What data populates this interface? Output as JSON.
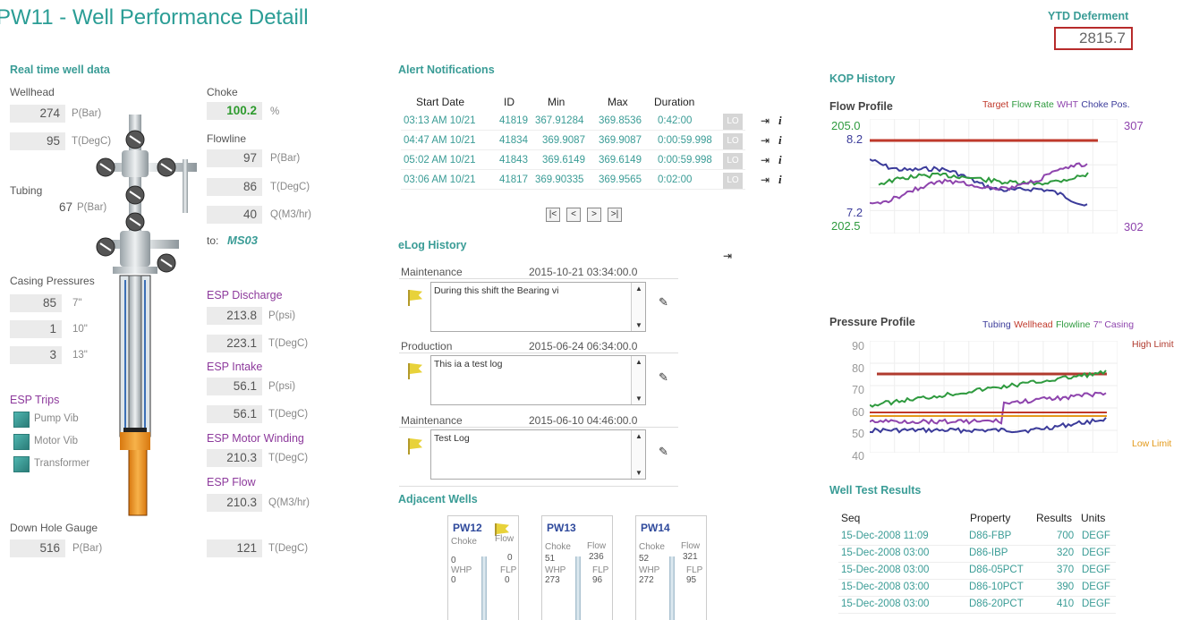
{
  "header": {
    "title": "PW11 - Well Performance Detaill",
    "ytd_label": "YTD Deferment",
    "ytd_value": "2815.7"
  },
  "realtime": {
    "section": "Real time well data",
    "wellhead_label": "Wellhead",
    "wellhead": [
      {
        "value": "274",
        "unit": "P(Bar)"
      },
      {
        "value": "95",
        "unit": "T(DegC)"
      }
    ],
    "tubing_label": "Tubing",
    "tubing": {
      "value": "67",
      "unit": "P(Bar)"
    },
    "choke_label": "Choke",
    "choke": {
      "value": "100.2",
      "unit": "%"
    },
    "flowline_label": "Flowline",
    "flowline": [
      {
        "value": "97",
        "unit": "P(Bar)"
      },
      {
        "value": "86",
        "unit": "T(DegC)"
      },
      {
        "value": "40",
        "unit": "Q(M3/hr)"
      }
    ],
    "to_label": "to:",
    "to_value": "MS03",
    "casing_label": "Casing Pressures",
    "casing": [
      {
        "value": "85",
        "unit": "7\""
      },
      {
        "value": "1",
        "unit": "10\""
      },
      {
        "value": "3",
        "unit": "13\""
      }
    ],
    "esp_trips_label": "ESP Trips",
    "esp_trips": [
      "Pump Vib",
      "Motor Vib",
      "Transformer"
    ],
    "esp_discharge_label": "ESP Discharge",
    "esp_discharge": [
      {
        "value": "213.8",
        "unit": "P(psi)"
      },
      {
        "value": "223.1",
        "unit": "T(DegC)"
      }
    ],
    "esp_intake_label": "ESP Intake",
    "esp_intake": [
      {
        "value": "56.1",
        "unit": "P(psi)"
      },
      {
        "value": "56.1",
        "unit": "T(DegC)"
      }
    ],
    "esp_motor_label": "ESP Motor Winding",
    "esp_motor": {
      "value": "210.3",
      "unit": "T(DegC)"
    },
    "esp_flow_label": "ESP Flow",
    "esp_flow": {
      "value": "210.3",
      "unit": "Q(M3/hr)"
    },
    "dhg_label": "Down Hole Gauge",
    "dhg": {
      "value": "516",
      "unit": "P(Bar)"
    },
    "dhg_temp": {
      "value": "121",
      "unit": "T(DegC)"
    }
  },
  "alerts": {
    "section": "Alert Notifications",
    "headers": [
      "Start Date",
      "ID",
      "Min",
      "Max",
      "Duration"
    ],
    "rows": [
      [
        "03:13 AM 10/21",
        "41819",
        "367.91284",
        "369.8536",
        "0:42:00",
        "LO"
      ],
      [
        "04:47 AM 10/21",
        "41834",
        "369.9087",
        "369.9087",
        "0:00:59.998",
        "LO"
      ],
      [
        "05:02 AM 10/21",
        "41843",
        "369.6149",
        "369.6149",
        "0:00:59.998",
        "LO"
      ],
      [
        "03:06 AM 10/21",
        "41817",
        "369.90335",
        "369.9565",
        "0:02:00",
        "LO"
      ]
    ],
    "nav": [
      "|<",
      "<",
      ">",
      ">|"
    ]
  },
  "elog": {
    "section": "eLog History",
    "entries": [
      {
        "category": "Maintenance",
        "date": "2015-10-21 03:34:00.0",
        "text": "During this shift the Bearing vi"
      },
      {
        "category": "Production",
        "date": "2015-06-24 06:34:00.0",
        "text": "This ia a test log"
      },
      {
        "category": "Maintenance",
        "date": "2015-06-10 04:46:00.0",
        "text": "Test Log"
      }
    ]
  },
  "adjacent": {
    "section": "Adjacent Wells",
    "labels": {
      "choke": "Choke",
      "flow": "Flow",
      "whp": "WHP",
      "flp": "FLP"
    },
    "wells": [
      {
        "name": "PW12",
        "choke": "0",
        "flow": "0",
        "whp": "0",
        "flp": "0"
      },
      {
        "name": "PW13",
        "choke": "51",
        "flow": "236",
        "whp": "273",
        "flp": "96"
      },
      {
        "name": "PW14",
        "choke": "52",
        "flow": "321",
        "whp": "272",
        "flp": "95"
      }
    ]
  },
  "kop": {
    "section": "KOP History",
    "flow_title": "Flow Profile",
    "flow_legend": [
      {
        "name": "Target",
        "color": "#c0392b"
      },
      {
        "name": "Flow Rate",
        "color": "#2e9a3e"
      },
      {
        "name": "WHT",
        "color": "#8e44ad"
      },
      {
        "name": "Choke Pos.",
        "color": "#3b3b9a"
      }
    ],
    "flow_left_top": "205.0",
    "flow_left_sub": "8.2",
    "flow_left_low": "7.2",
    "flow_left_bottom": "202.5",
    "flow_right_top": "307",
    "flow_right_bottom": "302",
    "pressure_title": "Pressure Profile",
    "pressure_legend": [
      {
        "name": "Tubing",
        "color": "#3b3b9a"
      },
      {
        "name": "Wellhead",
        "color": "#c0392b"
      },
      {
        "name": "Flowline",
        "color": "#2e9a3e"
      },
      {
        "name": "7\" Casing",
        "color": "#8e44ad"
      }
    ],
    "pressure_ticks": [
      "90",
      "80",
      "70",
      "60",
      "50",
      "40"
    ],
    "high_limit": "High Limit",
    "low_limit": "Low Limit",
    "high_color": "#b03a2e",
    "low_color": "#e39a1b"
  },
  "welltest": {
    "section": "Well Test Results",
    "headers": [
      "Seq",
      "Property",
      "Results",
      "Units"
    ],
    "rows": [
      [
        "15-Dec-2008 11:09",
        "D86-FBP",
        "700",
        "DEGF"
      ],
      [
        "15-Dec-2008 03:00",
        "D86-IBP",
        "320",
        "DEGF"
      ],
      [
        "15-Dec-2008 03:00",
        "D86-05PCT",
        "370",
        "DEGF"
      ],
      [
        "15-Dec-2008 03:00",
        "D86-10PCT",
        "390",
        "DEGF"
      ],
      [
        "15-Dec-2008 03:00",
        "D86-20PCT",
        "410",
        "DEGF"
      ]
    ]
  }
}
